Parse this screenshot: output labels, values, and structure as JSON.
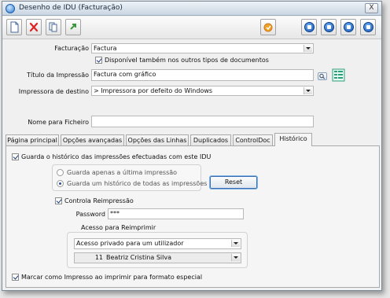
{
  "window": {
    "title": "Desenho de IDU (Facturação)",
    "close_label": "X"
  },
  "toolbar": {
    "buttons": [
      "new-document-icon",
      "delete-icon",
      "copy-icon",
      "import-icon",
      "action-icon"
    ],
    "nav": [
      "first-record-icon",
      "previous-record-icon",
      "next-record-icon",
      "last-record-icon"
    ]
  },
  "form": {
    "facturacao_label": "Facturação",
    "facturacao_value": "Factura",
    "disponivel_label": "Disponível também nos outros tipos de documentos",
    "titulo_label": "Título da Impressão",
    "titulo_value": "Factura com gráfico",
    "impressora_label": "Impressora de destino",
    "impressora_value": "> Impressora por defeito do Windows",
    "nome_ficheiro_label": "Nome para Ficheiro",
    "nome_ficheiro_value": ""
  },
  "tabs": [
    "Página principal",
    "Opções avançadas",
    "Opções das Linhas",
    "Duplicados",
    "ControlDoc",
    "Histórico"
  ],
  "historico": {
    "guarda_label": "Guarda o histórico das impressões efectuadas com este IDU",
    "radio_ultima": "Guarda apenas a última impressão",
    "radio_todas": "Guarda um histórico de todas as impressões",
    "reset_label": "Reset",
    "controla_label": "Controla Reimpressão",
    "password_label": "Password",
    "password_value": "***",
    "acesso_label": "Acesso para Reimprimir",
    "acesso_value": "Acesso privado para um utilizador",
    "user_id": "11",
    "user_name": "Beatriz Cristina Silva",
    "marcar_label": "Marcar como Impresso ao imprimir para formato especial"
  }
}
